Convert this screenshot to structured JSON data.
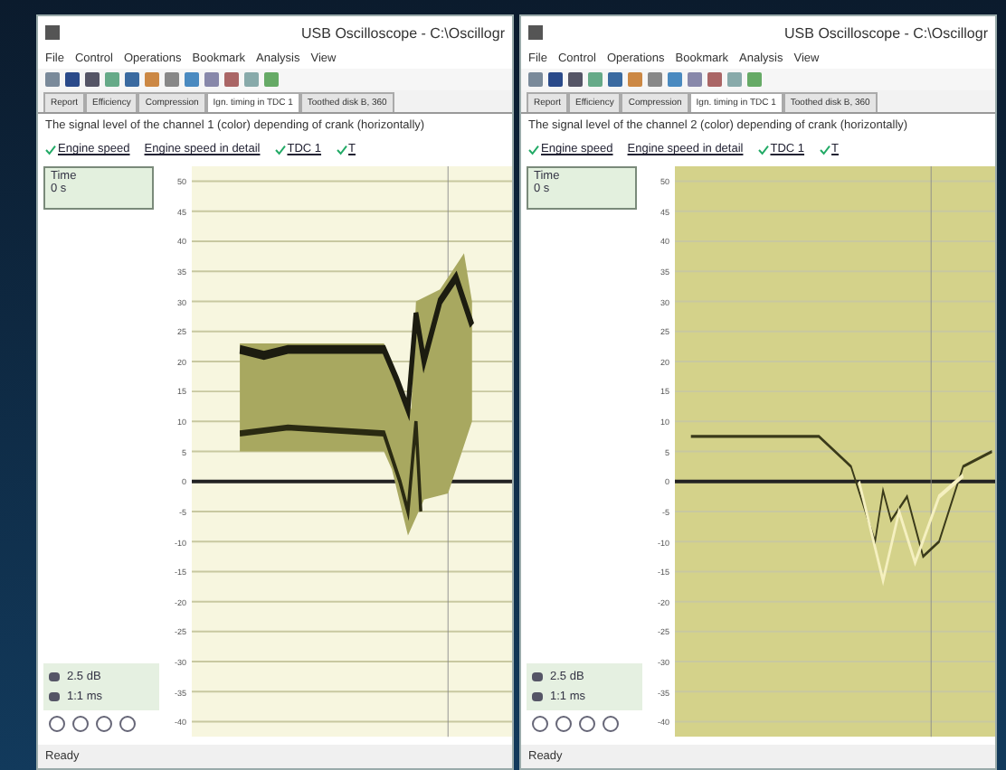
{
  "windows": [
    {
      "kind": "channel1",
      "title": "USB Oscilloscope - C:\\Oscillogr",
      "menu": [
        "File",
        "Control",
        "Operations",
        "Bookmark",
        "Analysis",
        "View"
      ],
      "tabs": [
        {
          "label": "Report",
          "selected": false
        },
        {
          "label": "Efficiency",
          "selected": false
        },
        {
          "label": "Compression",
          "selected": false
        },
        {
          "label": "Ign. timing in TDC 1",
          "selected": true
        },
        {
          "label": "Toothed disk B, 360",
          "selected": false
        }
      ],
      "description": "The signal level of the channel 1 (color) depending of crank (horizontally)",
      "links": [
        {
          "label": "Engine speed",
          "checked": true
        },
        {
          "label": "Engine speed in detail",
          "checked": false
        },
        {
          "label": "TDC 1",
          "checked": true
        },
        {
          "label": "T",
          "checked": true
        }
      ],
      "time": {
        "label": "Time",
        "value": "0 s"
      },
      "readouts": [
        "2.5 dB",
        "1:1 ms"
      ],
      "y_ticks": [
        "50",
        "45",
        "40",
        "35",
        "30",
        "25",
        "20",
        "15",
        "10",
        "5",
        "0",
        "-5",
        "-10",
        "-15",
        "-20",
        "-25",
        "-30",
        "-35",
        "-40"
      ],
      "status": "Ready"
    },
    {
      "kind": "channel2",
      "title": "USB Oscilloscope - C:\\Oscillogr",
      "menu": [
        "File",
        "Control",
        "Operations",
        "Bookmark",
        "Analysis",
        "View"
      ],
      "tabs": [
        {
          "label": "Report",
          "selected": false
        },
        {
          "label": "Efficiency",
          "selected": false
        },
        {
          "label": "Compression",
          "selected": false
        },
        {
          "label": "Ign. timing in TDC 1",
          "selected": true
        },
        {
          "label": "Toothed disk B, 360",
          "selected": false
        }
      ],
      "description": "The signal level of the channel 2 (color) depending of crank (horizontally)",
      "links": [
        {
          "label": "Engine speed",
          "checked": true
        },
        {
          "label": "Engine speed in detail",
          "checked": false
        },
        {
          "label": "TDC 1",
          "checked": true
        },
        {
          "label": "T",
          "checked": true
        }
      ],
      "time": {
        "label": "Time",
        "value": "0 s"
      },
      "readouts": [
        "2.5 dB",
        "1:1 ms"
      ],
      "y_ticks": [
        "50",
        "45",
        "40",
        "35",
        "30",
        "25",
        "20",
        "15",
        "10",
        "5",
        "0",
        "-5",
        "-10",
        "-15",
        "-20",
        "-25",
        "-30",
        "-35",
        "-40"
      ],
      "status": "Ready"
    }
  ]
}
